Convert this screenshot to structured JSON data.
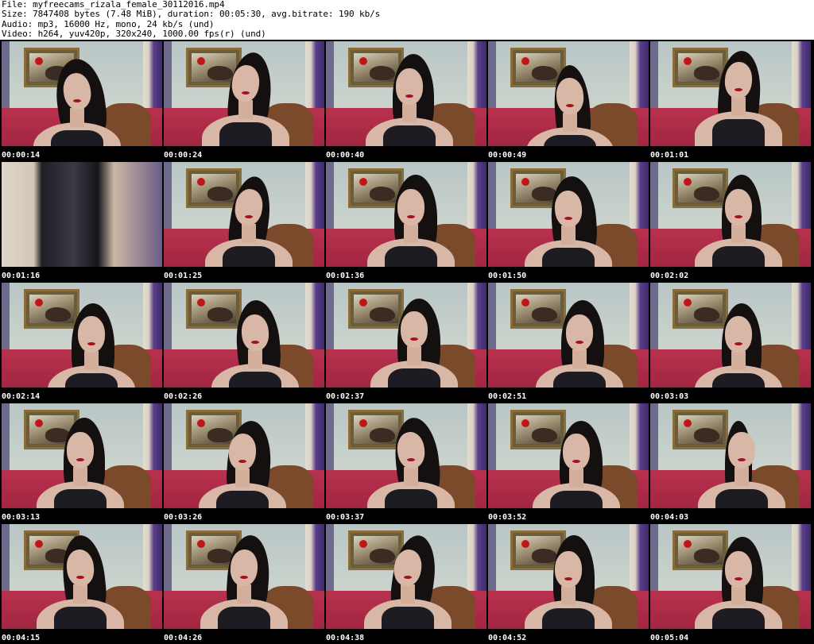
{
  "header": {
    "file": "File: myfreecams_rizala_female_30112016.mp4",
    "size": "Size: 7847408 bytes (7.48 MiB), duration: 00:05:30, avg.bitrate: 190 kb/s",
    "audio": "Audio: mp3, 16000 Hz, mono, 24 kb/s (und)",
    "video": "Video: h264, yuv420p, 320x240, 1000.00 fps(r) (und)"
  },
  "thumbnails": [
    {
      "time": "00:00:14"
    },
    {
      "time": "00:00:24"
    },
    {
      "time": "00:00:40"
    },
    {
      "time": "00:00:49"
    },
    {
      "time": "00:01:01"
    },
    {
      "time": "00:01:16"
    },
    {
      "time": "00:01:25"
    },
    {
      "time": "00:01:36"
    },
    {
      "time": "00:01:50"
    },
    {
      "time": "00:02:02"
    },
    {
      "time": "00:02:14"
    },
    {
      "time": "00:02:26"
    },
    {
      "time": "00:02:37"
    },
    {
      "time": "00:02:51"
    },
    {
      "time": "00:03:03"
    },
    {
      "time": "00:03:13"
    },
    {
      "time": "00:03:26"
    },
    {
      "time": "00:03:37"
    },
    {
      "time": "00:03:52"
    },
    {
      "time": "00:04:03"
    },
    {
      "time": "00:04:15"
    },
    {
      "time": "00:04:26"
    },
    {
      "time": "00:04:38"
    },
    {
      "time": "00:04:52"
    },
    {
      "time": "00:05:04"
    }
  ]
}
